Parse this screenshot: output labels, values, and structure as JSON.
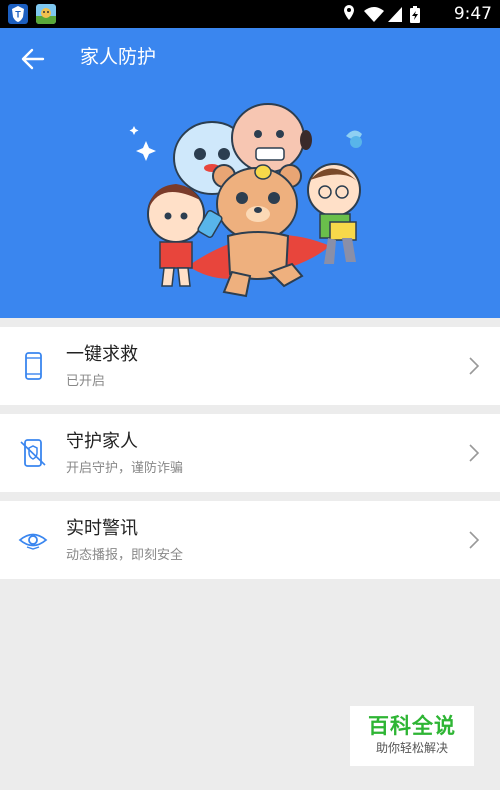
{
  "status_bar": {
    "time": "9:47",
    "icons": [
      "shield-app-icon",
      "game-app-icon",
      "location-icon",
      "wifi-icon",
      "signal-icon",
      "battery-icon"
    ]
  },
  "header": {
    "title": "家人防护",
    "background": "#3a86ef"
  },
  "items": [
    {
      "title": "一键求救",
      "subtitle": "已开启",
      "icon": "phone-icon"
    },
    {
      "title": "守护家人",
      "subtitle": "开启守护，谨防诈骗",
      "icon": "shield-phone-icon"
    },
    {
      "title": "实时警讯",
      "subtitle": "动态播报，即刻安全",
      "icon": "eye-icon"
    }
  ],
  "watermark": {
    "title": "百科全说",
    "subtitle": "助你轻松解决"
  }
}
